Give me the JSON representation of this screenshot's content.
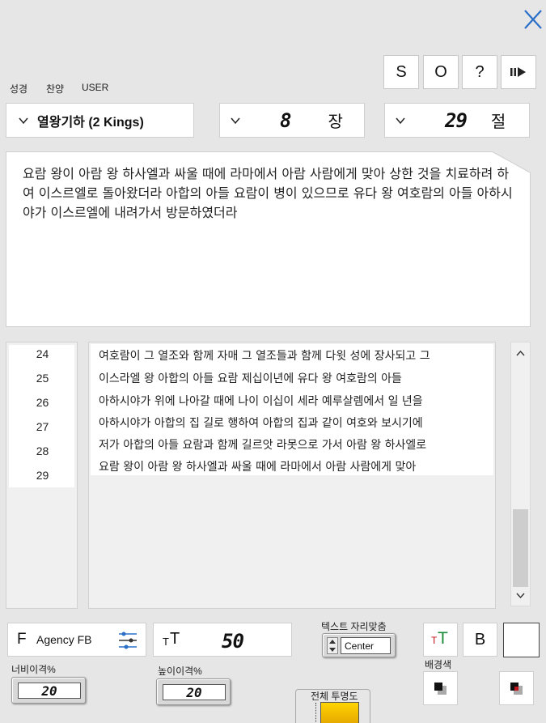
{
  "window": {
    "close_icon": "close-icon"
  },
  "toolbar": {
    "buttons": [
      {
        "label": "S"
      },
      {
        "label": "O"
      },
      {
        "label": "?"
      }
    ],
    "play_icon": "pause-play-icon"
  },
  "tabs": [
    {
      "label": "성경"
    },
    {
      "label": "찬양"
    },
    {
      "label": "USER"
    }
  ],
  "selectors": {
    "book": "열왕기하 (2 Kings)",
    "chapter": {
      "value": "8",
      "unit": "장"
    },
    "verse": {
      "value": "29",
      "unit": "절"
    }
  },
  "verse_display": {
    "text": "요람 왕이 아람 왕 하사엘과 싸울 때에 라마에서 아람 사람에게 맞아 상한 것을 치료하려 하여 이스르엘로 돌아왔더라 아합의 아들 요람이 병이 있으므로 유다 왕 여호람의 아들 아하시야가 이스르엘에 내려가서 방문하였더라"
  },
  "verse_list": {
    "numbers": [
      "24",
      "25",
      "26",
      "27",
      "28",
      "29"
    ],
    "lines": [
      "여호람이 그 열조와 함께 자매 그 열조들과 함께 다윗 성에 장사되고 그",
      "이스라엘 왕 아합의 아들 요람 제십이년에 유다 왕 여호람의 아들",
      "아하시야가 위에 나아갈 때에 나이 이십이 세라 예루살렘에서 일 년을",
      "아하시야가 아합의 집 길로 행하여 아합의 집과 같이 여호와 보시기에",
      "저가 아합의 아들 요람과 함께 길르앗 라못으로 가서 아람 왕 하사엘로",
      "요람 왕이 아람 왕 하사엘과 싸울 때에 라마에서 아람 사람에게 맞아"
    ]
  },
  "font_controls": {
    "font_prefix": "F",
    "font_name": "Agency FB",
    "size_prefix_small": "T",
    "size_prefix_large": "T",
    "size_value": "50",
    "align_label": "텍스트 자리맞춤",
    "align_value": "Center",
    "color_t_small": "T",
    "color_t_large": "T",
    "bold_label": "B",
    "bg_color_label": "배경색",
    "width_spacing_label": "너비이격%",
    "width_spacing_value": "20",
    "height_spacing_label": "높이이격%",
    "height_spacing_value": "20",
    "opacity_label": "전체 투명도"
  },
  "colors": {
    "accent_blue": "#2a70c8",
    "red": "#c0141e",
    "green": "#1e8c3c",
    "gold": "#f0b400"
  }
}
